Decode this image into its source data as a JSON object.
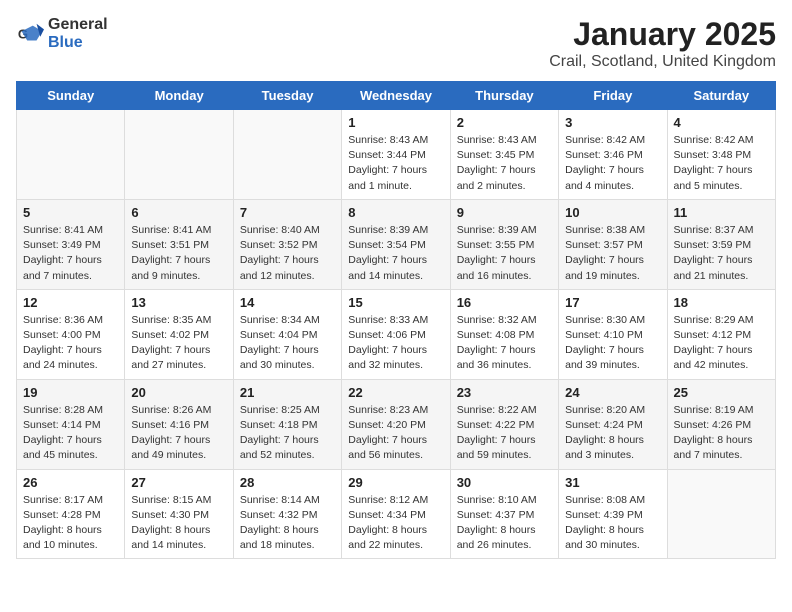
{
  "logo": {
    "general": "General",
    "blue": "Blue"
  },
  "title": "January 2025",
  "subtitle": "Crail, Scotland, United Kingdom",
  "weekdays": [
    "Sunday",
    "Monday",
    "Tuesday",
    "Wednesday",
    "Thursday",
    "Friday",
    "Saturday"
  ],
  "weeks": [
    [
      {
        "day": "",
        "info": ""
      },
      {
        "day": "",
        "info": ""
      },
      {
        "day": "",
        "info": ""
      },
      {
        "day": "1",
        "info": "Sunrise: 8:43 AM\nSunset: 3:44 PM\nDaylight: 7 hours\nand 1 minute."
      },
      {
        "day": "2",
        "info": "Sunrise: 8:43 AM\nSunset: 3:45 PM\nDaylight: 7 hours\nand 2 minutes."
      },
      {
        "day": "3",
        "info": "Sunrise: 8:42 AM\nSunset: 3:46 PM\nDaylight: 7 hours\nand 4 minutes."
      },
      {
        "day": "4",
        "info": "Sunrise: 8:42 AM\nSunset: 3:48 PM\nDaylight: 7 hours\nand 5 minutes."
      }
    ],
    [
      {
        "day": "5",
        "info": "Sunrise: 8:41 AM\nSunset: 3:49 PM\nDaylight: 7 hours\nand 7 minutes."
      },
      {
        "day": "6",
        "info": "Sunrise: 8:41 AM\nSunset: 3:51 PM\nDaylight: 7 hours\nand 9 minutes."
      },
      {
        "day": "7",
        "info": "Sunrise: 8:40 AM\nSunset: 3:52 PM\nDaylight: 7 hours\nand 12 minutes."
      },
      {
        "day": "8",
        "info": "Sunrise: 8:39 AM\nSunset: 3:54 PM\nDaylight: 7 hours\nand 14 minutes."
      },
      {
        "day": "9",
        "info": "Sunrise: 8:39 AM\nSunset: 3:55 PM\nDaylight: 7 hours\nand 16 minutes."
      },
      {
        "day": "10",
        "info": "Sunrise: 8:38 AM\nSunset: 3:57 PM\nDaylight: 7 hours\nand 19 minutes."
      },
      {
        "day": "11",
        "info": "Sunrise: 8:37 AM\nSunset: 3:59 PM\nDaylight: 7 hours\nand 21 minutes."
      }
    ],
    [
      {
        "day": "12",
        "info": "Sunrise: 8:36 AM\nSunset: 4:00 PM\nDaylight: 7 hours\nand 24 minutes."
      },
      {
        "day": "13",
        "info": "Sunrise: 8:35 AM\nSunset: 4:02 PM\nDaylight: 7 hours\nand 27 minutes."
      },
      {
        "day": "14",
        "info": "Sunrise: 8:34 AM\nSunset: 4:04 PM\nDaylight: 7 hours\nand 30 minutes."
      },
      {
        "day": "15",
        "info": "Sunrise: 8:33 AM\nSunset: 4:06 PM\nDaylight: 7 hours\nand 32 minutes."
      },
      {
        "day": "16",
        "info": "Sunrise: 8:32 AM\nSunset: 4:08 PM\nDaylight: 7 hours\nand 36 minutes."
      },
      {
        "day": "17",
        "info": "Sunrise: 8:30 AM\nSunset: 4:10 PM\nDaylight: 7 hours\nand 39 minutes."
      },
      {
        "day": "18",
        "info": "Sunrise: 8:29 AM\nSunset: 4:12 PM\nDaylight: 7 hours\nand 42 minutes."
      }
    ],
    [
      {
        "day": "19",
        "info": "Sunrise: 8:28 AM\nSunset: 4:14 PM\nDaylight: 7 hours\nand 45 minutes."
      },
      {
        "day": "20",
        "info": "Sunrise: 8:26 AM\nSunset: 4:16 PM\nDaylight: 7 hours\nand 49 minutes."
      },
      {
        "day": "21",
        "info": "Sunrise: 8:25 AM\nSunset: 4:18 PM\nDaylight: 7 hours\nand 52 minutes."
      },
      {
        "day": "22",
        "info": "Sunrise: 8:23 AM\nSunset: 4:20 PM\nDaylight: 7 hours\nand 56 minutes."
      },
      {
        "day": "23",
        "info": "Sunrise: 8:22 AM\nSunset: 4:22 PM\nDaylight: 7 hours\nand 59 minutes."
      },
      {
        "day": "24",
        "info": "Sunrise: 8:20 AM\nSunset: 4:24 PM\nDaylight: 8 hours\nand 3 minutes."
      },
      {
        "day": "25",
        "info": "Sunrise: 8:19 AM\nSunset: 4:26 PM\nDaylight: 8 hours\nand 7 minutes."
      }
    ],
    [
      {
        "day": "26",
        "info": "Sunrise: 8:17 AM\nSunset: 4:28 PM\nDaylight: 8 hours\nand 10 minutes."
      },
      {
        "day": "27",
        "info": "Sunrise: 8:15 AM\nSunset: 4:30 PM\nDaylight: 8 hours\nand 14 minutes."
      },
      {
        "day": "28",
        "info": "Sunrise: 8:14 AM\nSunset: 4:32 PM\nDaylight: 8 hours\nand 18 minutes."
      },
      {
        "day": "29",
        "info": "Sunrise: 8:12 AM\nSunset: 4:34 PM\nDaylight: 8 hours\nand 22 minutes."
      },
      {
        "day": "30",
        "info": "Sunrise: 8:10 AM\nSunset: 4:37 PM\nDaylight: 8 hours\nand 26 minutes."
      },
      {
        "day": "31",
        "info": "Sunrise: 8:08 AM\nSunset: 4:39 PM\nDaylight: 8 hours\nand 30 minutes."
      },
      {
        "day": "",
        "info": ""
      }
    ]
  ]
}
